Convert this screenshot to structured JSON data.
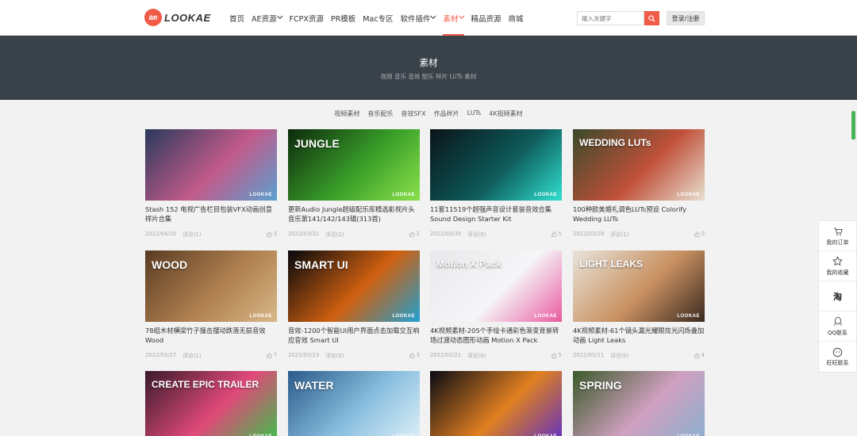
{
  "header": {
    "logo_mark": "ae",
    "logo_text": "LOOKAE",
    "nav": [
      {
        "label": "首页",
        "active": false,
        "dropdown": false
      },
      {
        "label": "AE资源",
        "active": false,
        "dropdown": true
      },
      {
        "label": "FCPX资源",
        "active": false,
        "dropdown": false
      },
      {
        "label": "PR模板",
        "active": false,
        "dropdown": false
      },
      {
        "label": "Mac专区",
        "active": false,
        "dropdown": false
      },
      {
        "label": "软件插件",
        "active": false,
        "dropdown": true
      },
      {
        "label": "素材",
        "active": true,
        "dropdown": true
      },
      {
        "label": "精品资源",
        "active": false,
        "dropdown": false
      },
      {
        "label": "商城",
        "active": false,
        "dropdown": false
      }
    ],
    "search_placeholder": "输入关键字",
    "login_label": "登录/注册"
  },
  "banner": {
    "title": "素材",
    "subtitle": "视频 音乐 音效 配乐 样片 LUTs 素材"
  },
  "filters": [
    "视频素材",
    "音乐配乐",
    "音效SFX",
    "作品样片",
    "LUTs",
    "4K视频素材"
  ],
  "cards": [
    {
      "title": "Stash 152 电视广告栏目包装VFX动画创意样片合集",
      "date": "2022/04/10",
      "comments": "评论(1)",
      "likes": "3",
      "thumb_text": "",
      "colors": [
        "#2a3a5c",
        "#c25a8a",
        "#5aa0d0"
      ]
    },
    {
      "title": "更新Audio Jungle超级配乐库精选影视片头音乐第141/142/143辑(313首)",
      "date": "2022/03/31",
      "comments": "评论(2)",
      "likes": "2",
      "thumb_text": "JUNGLE",
      "colors": [
        "#0d2a0d",
        "#3aa02a",
        "#8ae04a"
      ]
    },
    {
      "title": "11套11519个超强声音设计套装音效合集 Sound Design Starter Kit",
      "date": "2022/03/30",
      "comments": "评论(0)",
      "likes": "5",
      "thumb_text": "",
      "colors": [
        "#0a1418",
        "#0e5a5a",
        "#30e0d0"
      ]
    },
    {
      "title": "100种欧美婚礼调色LUTs预设 Colorify Wedding LUTs",
      "date": "2022/03/28",
      "comments": "评论(1)",
      "likes": "0",
      "thumb_text": "WEDDING LUTs",
      "colors": [
        "#3a4a2a",
        "#c0503a",
        "#e8e0d0"
      ]
    },
    {
      "title": "78组木材横梁竹子撞击摆动跌落无损音效 Wood",
      "date": "2022/03/27",
      "comments": "评论(1)",
      "likes": "7",
      "thumb_text": "WOOD",
      "colors": [
        "#5a3c22",
        "#b08050",
        "#d8b888"
      ]
    },
    {
      "title": "音效-1200个智能UI用户界面点击加载交互响应音效 Smart UI",
      "date": "2022/03/23",
      "comments": "评论(0)",
      "likes": "3",
      "thumb_text": "SMART UI",
      "colors": [
        "#05080c",
        "#d06010",
        "#20a0d0"
      ]
    },
    {
      "title": "4K视频素材-205个手绘卡通彩色渐变背景转场过渡动态图形动画 Motion X Pack",
      "date": "2022/03/21",
      "comments": "评论(0)",
      "likes": "5",
      "thumb_text": "Motion X Pack",
      "colors": [
        "#e8e8ec",
        "#f6f6f8",
        "#e85aa0"
      ]
    },
    {
      "title": "4K视频素材-61个镜头漏光耀眼炫光闪烁叠加动画 Light Leaks",
      "date": "2022/03/21",
      "comments": "评论(0)",
      "likes": "4",
      "thumb_text": "LIGHT LEAKS",
      "colors": [
        "#e8e4dc",
        "#c89060",
        "#3a2a20"
      ]
    },
    {
      "title": "",
      "date": "",
      "comments": "",
      "likes": "",
      "thumb_text": "CREATE EPIC TRAILER",
      "colors": [
        "#3a1a2a",
        "#e04a7a",
        "#3ac04a"
      ]
    },
    {
      "title": "",
      "date": "",
      "comments": "",
      "likes": "",
      "thumb_text": "WATER",
      "colors": [
        "#2a5a8a",
        "#8ac0e0",
        "#e0f0f8"
      ]
    },
    {
      "title": "",
      "date": "",
      "comments": "",
      "likes": "",
      "thumb_text": "",
      "colors": [
        "#0a0a14",
        "#e08020",
        "#6030c0"
      ]
    },
    {
      "title": "",
      "date": "",
      "comments": "",
      "likes": "",
      "thumb_text": "SPRING",
      "colors": [
        "#3a5a2a",
        "#d0a0c0",
        "#8ab0d0"
      ]
    }
  ],
  "thumb_brand": "LOOKAE",
  "float_bar": [
    {
      "label": "我的订单",
      "icon": "cart-icon"
    },
    {
      "label": "我的收藏",
      "icon": "star-icon"
    },
    {
      "label": "",
      "icon": "taobao-icon",
      "glyph": "淘"
    },
    {
      "label": "QQ联系",
      "icon": "qq-icon"
    },
    {
      "label": "旺旺联系",
      "icon": "wangwang-icon"
    }
  ],
  "accent": "#f05b47"
}
